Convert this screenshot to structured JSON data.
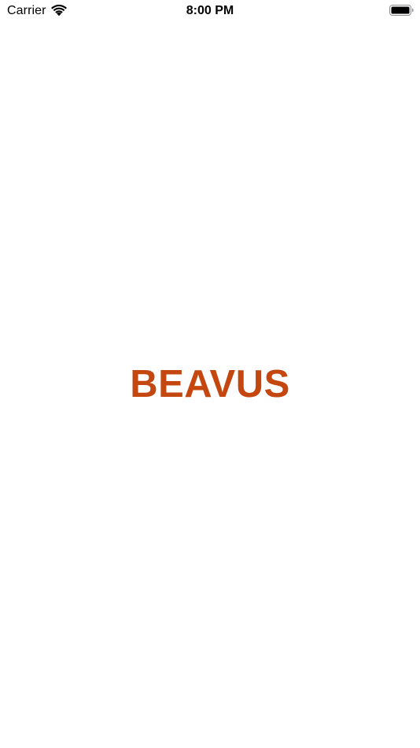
{
  "status_bar": {
    "carrier": "Carrier",
    "time": "8:00 PM",
    "icons": [
      "wifi-icon",
      "battery-icon"
    ]
  },
  "splash": {
    "brand_name": "BEAVUS"
  },
  "colors": {
    "brand": "#c4470f",
    "background": "#ffffff",
    "status_text": "#000000"
  }
}
